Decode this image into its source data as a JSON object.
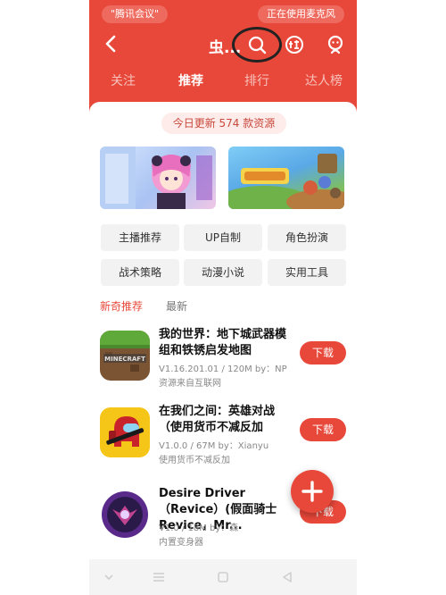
{
  "status_bar": {
    "left_pill": "\"腾讯会议\"",
    "right_pill": "正在使用麦克风"
  },
  "header": {
    "title": "虫..."
  },
  "tabs": [
    {
      "label": "关注",
      "active": false
    },
    {
      "label": "推荐",
      "active": true
    },
    {
      "label": "排行",
      "active": false
    },
    {
      "label": "达人榜",
      "active": false
    }
  ],
  "update_notice": "今日更新 574 款资源",
  "categories": [
    "主播推荐",
    "UP自制",
    "角色扮演",
    "战术策略",
    "动漫小说",
    "实用工具"
  ],
  "subtabs": [
    {
      "label": "新奇推荐",
      "active": true
    },
    {
      "label": "最新",
      "active": false
    }
  ],
  "apps": [
    {
      "name": "我的世界：地下城武器模组和铁锈启发地图",
      "meta": "V1.16.201.01 / 120M  by：NP",
      "desc": "资源来自互联网",
      "download_label": "下载"
    },
    {
      "name": "在我们之间：英雄对战（使用货币不减反加",
      "meta": "V1.0.0 / 67M  by：Xianyu",
      "desc": "使用货币不减反加",
      "download_label": "下载"
    },
    {
      "name": "Desire Driver（Revice）(假面骑士Revice，Mr...",
      "meta": "V1.0 / 18M  by：森",
      "desc": "内置变身器",
      "download_label": "下载"
    }
  ],
  "colors": {
    "brand": "#e8483a",
    "content_bg": "#ffffff",
    "chip_bg": "#f2f2f2"
  }
}
